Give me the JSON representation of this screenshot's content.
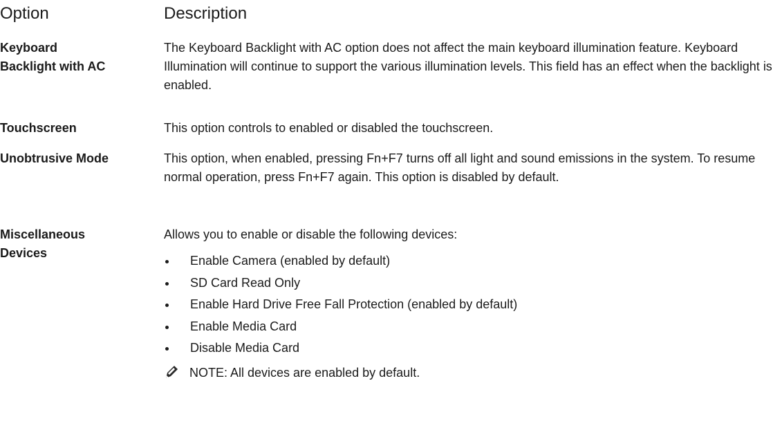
{
  "header": {
    "option": "Option",
    "description": "Description"
  },
  "rows": [
    {
      "option_line1": "Keyboard",
      "option_line2": "Backlight with AC",
      "description": "The Keyboard Backlight with AC option does not affect the main keyboard illumination feature. Keyboard Illumination will continue to support the various illumination levels. This field has an effect when the backlight is enabled."
    },
    {
      "option_line1": "Touchscreen",
      "description": "This option controls to enabled or disabled the touchscreen."
    },
    {
      "option_line1": "Unobtrusive Mode",
      "description": "This option, when enabled, pressing Fn+F7 turns off all light and sound emissions in the system. To resume normal operation, press Fn+F7 again. This option is disabled by default."
    },
    {
      "option_line1": "Miscellaneous",
      "option_line2": "Devices",
      "description": "Allows you to enable or disable the following devices:",
      "bullets": [
        "Enable Camera (enabled by default)",
        "SD Card Read Only",
        "Enable Hard Drive Free Fall Protection (enabled by default)",
        "Enable Media Card",
        "Disable Media Card"
      ]
    }
  ],
  "note": {
    "icon": "pencil-note-icon",
    "label": "NOTE:",
    "text": " All devices are enabled by default."
  }
}
